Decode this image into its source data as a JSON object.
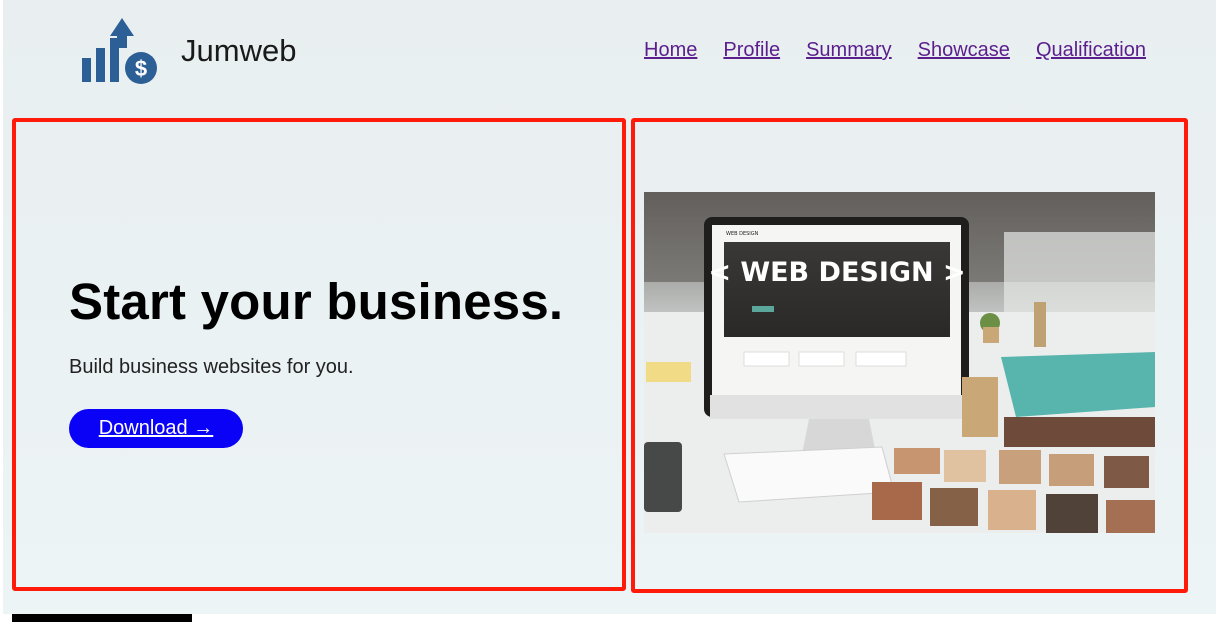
{
  "header": {
    "brand": "Jumweb",
    "logo_icon": "growth-chart-dollar-icon",
    "nav": [
      "Home",
      "Profile",
      "Summary",
      "Showcase",
      "Qualification"
    ]
  },
  "hero": {
    "headline": "Start your business.",
    "subline": "Build business websites for you.",
    "download_label": "Download →"
  },
  "image": {
    "screen_title": "< WEB DESIGN >",
    "screen_brand": "WEB DESIGN"
  },
  "colors": {
    "accent_button": "#0a02f6",
    "nav_link": "#5b1e8c",
    "highlight_border": "#ff1a0a",
    "logo_blue": "#2d5f97"
  }
}
